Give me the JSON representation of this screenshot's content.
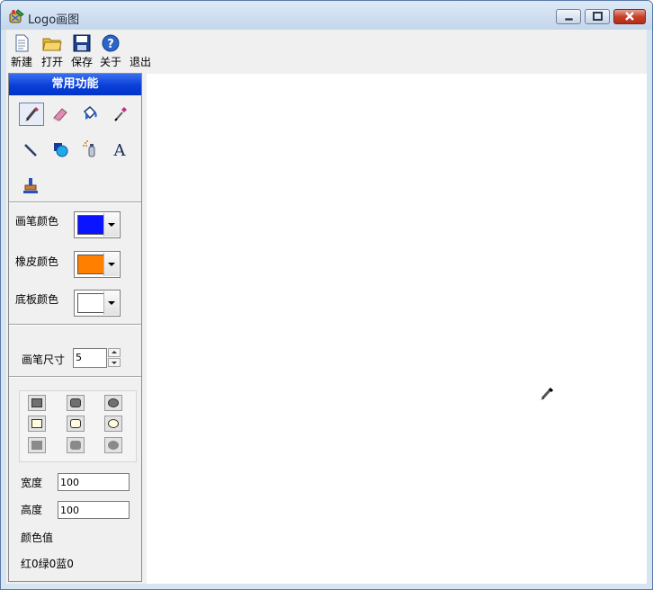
{
  "window": {
    "title": "Logo画图"
  },
  "toolbar": {
    "new": "新建",
    "open": "打开",
    "save": "保存",
    "about": "关于",
    "exit": "退出"
  },
  "panel": {
    "header": "常用功能",
    "pen_color_label": "画笔颜色",
    "eraser_color_label": "橡皮颜色",
    "background_color_label": "底板颜色",
    "pen_size_label": "画笔尺寸",
    "pen_size_value": "5",
    "width_label": "宽度",
    "width_value": "100",
    "height_label": "高度",
    "height_value": "100",
    "color_value_label": "颜色值",
    "color_value": "红0绿0蓝0",
    "text_tool_glyph": "A"
  },
  "colors": {
    "pen": "#0a14ff",
    "eraser": "#ff7f00",
    "background": "#ffffff",
    "panel_header": "#0a3fd8"
  },
  "icons": [
    "brush-icon",
    "eraser-icon",
    "fill-icon",
    "eyedropper-icon",
    "line-icon",
    "shapes-icon",
    "spray-icon",
    "text-icon",
    "stamp-icon"
  ]
}
